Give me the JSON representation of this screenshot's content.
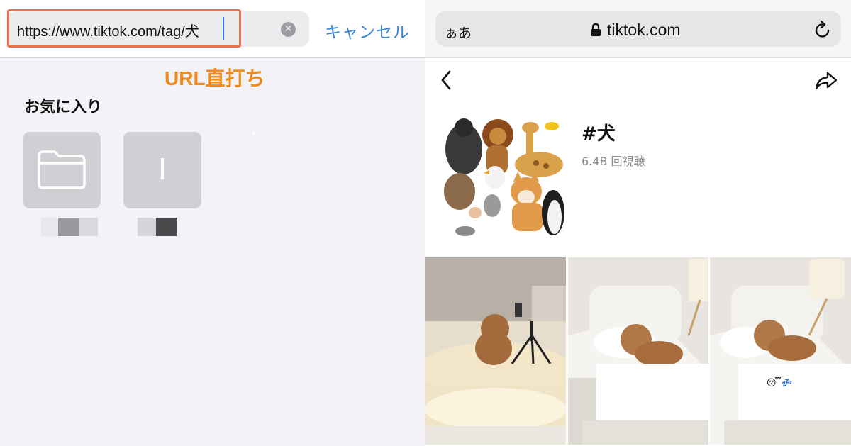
{
  "left": {
    "url_value": "https://www.tiktok.com/tag/犬",
    "cancel_label": "キャンセル",
    "annotation": "URL直打ち",
    "favorites_title": "お気に入り",
    "favorites": [
      {
        "kind": "folder",
        "icon": "folder-icon"
      },
      {
        "kind": "letter",
        "letter": "I"
      }
    ],
    "clear_icon": "clear-icon",
    "highlight_color": "#e8734f",
    "annotation_color": "#f08a1a",
    "accent_color": "#3a86d6"
  },
  "right": {
    "text_size_label": "ぁあ",
    "domain": "tiktok.com",
    "tag_name": "#犬",
    "views": "6.4B 回視聴",
    "icons": [
      "lock-icon",
      "reload-icon",
      "back-chevron-icon",
      "share-icon"
    ],
    "thumbnail_emoji": "😴💤"
  }
}
